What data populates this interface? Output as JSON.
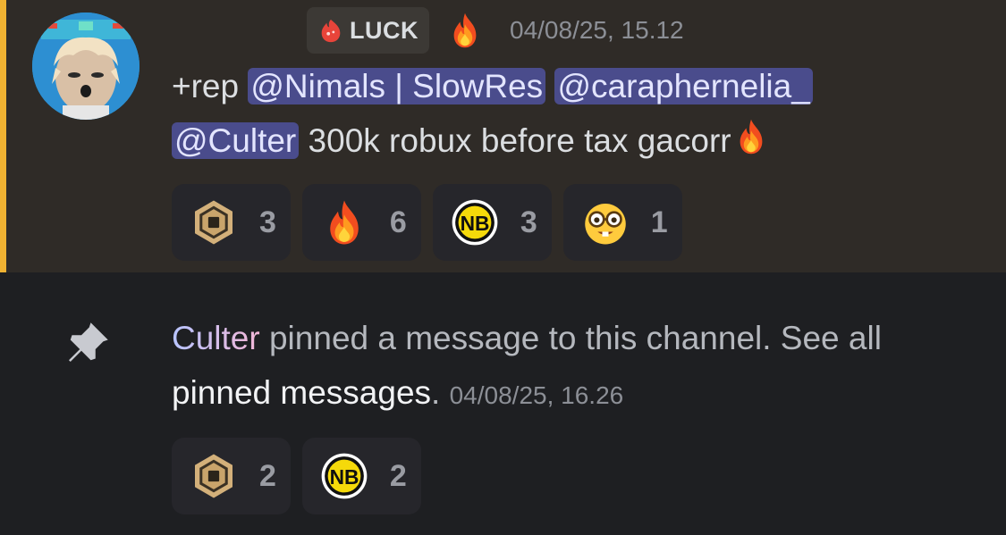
{
  "message": {
    "role_tag": "LUCK",
    "timestamp": "04/08/25, 15.12",
    "text_prefix": "+rep",
    "mentions": [
      "@Nimals | SlowRes",
      "@caraphernelia_",
      "@Culter"
    ],
    "text_suffix": "300k robux before tax gacorr",
    "reactions": [
      {
        "icon": "robux-icon",
        "count": "3"
      },
      {
        "icon": "fire-icon",
        "count": "6"
      },
      {
        "icon": "nb-logo-icon",
        "count": "3"
      },
      {
        "icon": "nerd-face-icon",
        "count": "1"
      }
    ]
  },
  "system_message": {
    "actor": "Culter",
    "text": "pinned a message to this channel. See all",
    "link": "pinned messages",
    "period": ".",
    "timestamp": "04/08/25, 16.26",
    "reactions": [
      {
        "icon": "robux-icon",
        "count": "2"
      },
      {
        "icon": "nb-logo-icon",
        "count": "2"
      }
    ]
  },
  "colors": {
    "highlight_bg": "#2f2b27",
    "highlight_bar": "#f0b232",
    "mention_bg": "#4a4c8c",
    "app_bg": "#1e1f22"
  }
}
